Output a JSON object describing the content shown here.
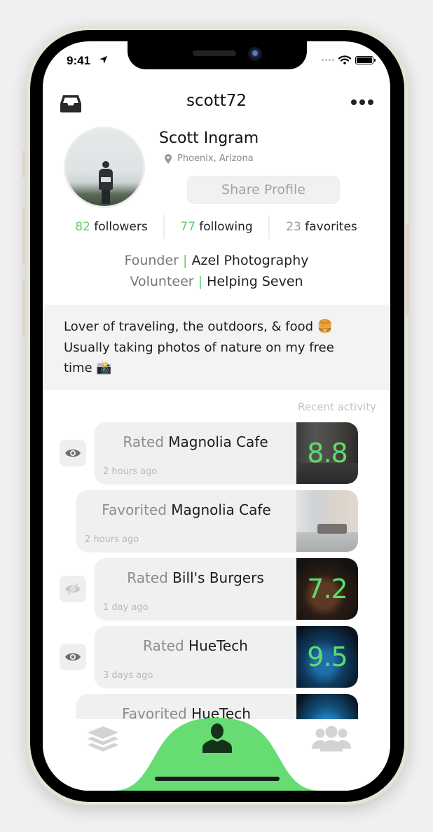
{
  "status_bar": {
    "time": "9:41",
    "icons": [
      "location-arrow-icon",
      "cellular-signal-icon",
      "wifi-icon",
      "battery-icon"
    ]
  },
  "header": {
    "username": "scott72",
    "left_icon": "inbox-tray-icon",
    "right_icon": "more-dots-icon"
  },
  "profile": {
    "name": "Scott Ingram",
    "location": "Phoenix, Arizona",
    "location_icon": "map-pin-icon",
    "share_label": "Share Profile"
  },
  "stats": [
    {
      "value": "82",
      "label": "followers"
    },
    {
      "value": "77",
      "label": "following"
    },
    {
      "value": "23",
      "label": "favorites"
    }
  ],
  "roles": [
    {
      "role": "Founder",
      "separator": "|",
      "org": "Azel Photography"
    },
    {
      "role": "Volunteer",
      "separator": "|",
      "org": "Helping Seven"
    }
  ],
  "bio": {
    "line1": "Lover of traveling, the outdoors, & food 🍔",
    "line2": "Usually taking photos of nature on my free",
    "line3": "time 📸"
  },
  "recent_activity": {
    "label": "Recent activity",
    "items": [
      {
        "visibility": "visible",
        "verb": "Rated",
        "place": "Magnolia Cafe",
        "time": "2 hours ago",
        "score": "8.8",
        "thumb": "cafe-dark"
      },
      {
        "visibility": null,
        "verb": "Favorited",
        "place": "Magnolia Cafe",
        "time": "2 hours ago",
        "score": null,
        "thumb": "cafe-light"
      },
      {
        "visibility": "hidden",
        "verb": "Rated",
        "place": "Bill's Burgers",
        "time": "1 day ago",
        "score": "7.2",
        "thumb": "burger"
      },
      {
        "visibility": "visible",
        "verb": "Rated",
        "place": "HueTech",
        "time": "3 days ago",
        "score": "9.5",
        "thumb": "huetech"
      },
      {
        "visibility": null,
        "verb": "Favorited",
        "place": "HueTech",
        "time": "",
        "score": null,
        "thumb": "huetech2"
      }
    ]
  },
  "tabbar": {
    "tabs": [
      {
        "name": "feed",
        "icon": "layers-icon",
        "active": false
      },
      {
        "name": "profile",
        "icon": "person-icon",
        "active": true
      },
      {
        "name": "friends",
        "icon": "group-icon",
        "active": false
      }
    ],
    "accent_color": "#66dc72"
  },
  "colors": {
    "accent_green": "#5fcf6a",
    "score_green": "#5fdc6a",
    "muted_grey": "#999999"
  }
}
